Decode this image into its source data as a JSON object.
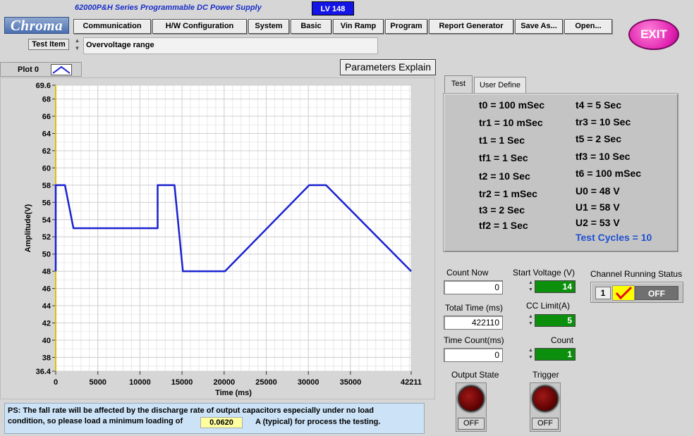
{
  "header": {
    "logo": "Chroma",
    "app_title": "62000P&H Series  Programmable DC Power Supply",
    "version": "LV 148",
    "exit_label": "EXIT"
  },
  "menu": [
    "Communication",
    "H/W Configuration",
    "System",
    "Basic",
    "Vin Ramp",
    "Program",
    "Report Generator",
    "Save As...",
    "Open..."
  ],
  "test_item": {
    "label": "Test Item",
    "value": "Overvoltage range"
  },
  "plot_legend": {
    "label": "Plot 0"
  },
  "params_explain_label": "Parameters Explain",
  "tabs": [
    "Test",
    "User Define"
  ],
  "parameters": {
    "left": [
      "t0 = 100 mSec",
      "tr1 = 10 mSec",
      "t1 = 1 Sec",
      "tf1 = 1 Sec",
      "t2 = 10 Sec",
      "tr2 = 1 mSec",
      "t3 = 2 Sec",
      "tf2 = 1 Sec"
    ],
    "right": [
      "t4 = 5 Sec",
      "tr3 = 10 Sec",
      "t5 = 2 Sec",
      "tf3 = 10 Sec",
      "t6 = 100 mSec",
      "U0 = 48 V",
      "U1 = 58 V",
      "U2 = 53 V"
    ],
    "cycles": "Test Cycles = 10"
  },
  "counters": {
    "count_now_label": "Count Now",
    "count_now": "0",
    "total_time_label": "Total Time (ms)",
    "total_time": "422110",
    "time_count_label": "Time Count(ms)",
    "time_count": "0"
  },
  "settings": {
    "start_voltage_label": "Start Voltage (V)",
    "start_voltage": "14",
    "cc_limit_label": "CC Limit(A)",
    "cc_limit": "5",
    "count_label": "Count",
    "count": "1"
  },
  "channel_status": {
    "label": "Channel Running Status",
    "channel": "1",
    "state": "OFF"
  },
  "output_state": {
    "label": "Output State",
    "value": "OFF"
  },
  "trigger": {
    "label": "Trigger",
    "value": "OFF"
  },
  "ps_note": {
    "line1": "PS: The fall rate will be affected by the discharge rate of output capacitors especially under no load",
    "line2": "condition, so please load a minimum loading of",
    "value": "0.0620",
    "suffix": "A (typical) for process the testing."
  },
  "colors": {
    "trace": "#1a22d0",
    "accent_green": "#0c8f0c",
    "exit_pink": "#e020b0",
    "lv_blue": "#1414e6"
  },
  "chart_data": {
    "type": "line",
    "xlabel": "Time (ms)",
    "ylabel": "Amplitude(V)",
    "xlim": [
      0,
      42211
    ],
    "ylim": [
      36.4,
      69.6
    ],
    "x_ticks": [
      "0",
      "5000",
      "10000",
      "15000",
      "20000",
      "25000",
      "30000",
      "35000",
      "42211"
    ],
    "y_ticks": [
      "69.6",
      "68",
      "66",
      "64",
      "62",
      "60",
      "58",
      "56",
      "54",
      "52",
      "50",
      "48",
      "46",
      "44",
      "42",
      "40",
      "38",
      "36.4"
    ],
    "grid": true,
    "series": [
      {
        "name": "Plot 0",
        "x": [
          0,
          0,
          1100,
          2100,
          12100,
          12100,
          14100,
          15100,
          20100,
          30100,
          32100,
          42211
        ],
        "y": [
          48,
          58,
          58,
          53,
          53,
          58,
          58,
          48,
          48,
          58,
          58,
          48
        ]
      }
    ]
  }
}
